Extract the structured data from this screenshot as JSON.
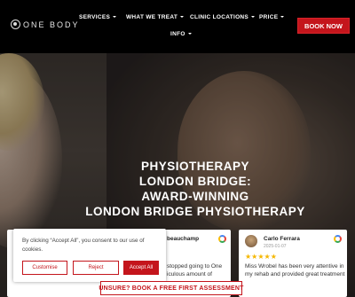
{
  "brand": {
    "logo_text": "ONE BODY"
  },
  "nav": {
    "items": [
      {
        "label": "SERVICES",
        "has_dropdown": true
      },
      {
        "label": "WHAT WE TREAT",
        "has_dropdown": true
      },
      {
        "label": "CLINIC LOCATIONS",
        "has_dropdown": true
      },
      {
        "label": "PRICE",
        "has_dropdown": true
      },
      {
        "label": "INFO",
        "has_dropdown": true
      }
    ],
    "book_now": "BOOK NOW"
  },
  "hero": {
    "title_lines": [
      "PHYSIOTHERAPY",
      "LONDON BRIDGE:",
      "AWARD-WINNING",
      "LONDON BRIDGE PHYSIOTHERAPY"
    ]
  },
  "reviews": [
    {
      "name": "beauchamp",
      "text_lines": [
        "stopped going to One",
        "iculous amount of"
      ]
    },
    {
      "name": "Carlo Ferrara",
      "date": "2025-01-07",
      "rating": 5,
      "text_lines": [
        "Miss Wrobel has been very attentive in",
        "my rehab and provided great treatment"
      ]
    }
  ],
  "cookie": {
    "text": "By clicking “Accept All”, you consent to our use of cookies.",
    "customise": "Customise",
    "reject": "Reject",
    "accept": "Accept All"
  },
  "cta": {
    "label": "UNSURE? BOOK A FREE FIRST ASSESSMENT"
  },
  "colors": {
    "accent": "#c4151c",
    "star": "#f5b700",
    "header_bg": "#000000"
  }
}
